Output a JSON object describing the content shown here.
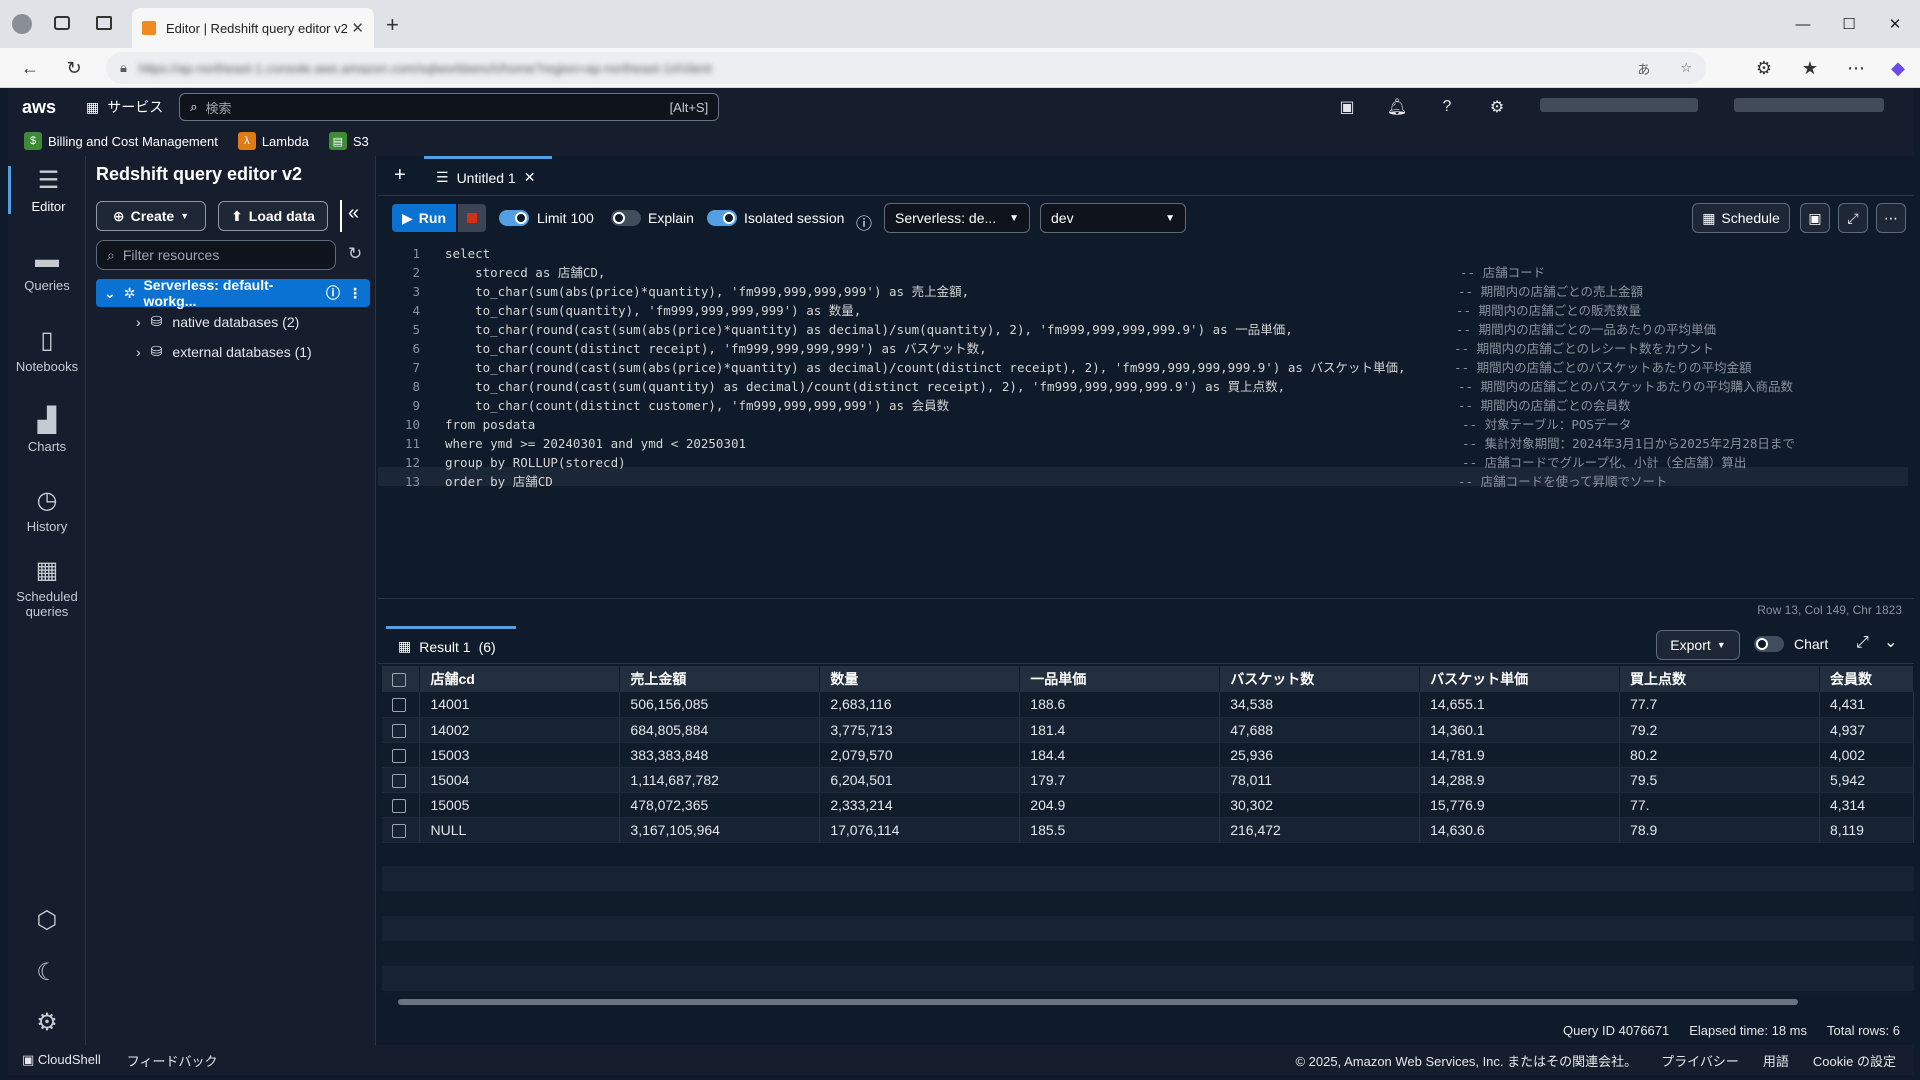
{
  "browser": {
    "tab_title": "Editor | Redshift query editor v2",
    "url": "https://ap-northeast-1.console.aws.amazon.com/sqlworkbench/home?region=ap-northeast-1#/client"
  },
  "aws_header": {
    "logo": "aws",
    "services_label": "サービス",
    "search_placeholder": "検索",
    "search_shortcut": "[Alt+S]"
  },
  "favorites": [
    {
      "label": "Billing and Cost Management",
      "color": "#3d8b37"
    },
    {
      "label": "Lambda",
      "color": "#e07b17"
    },
    {
      "label": "S3",
      "color": "#3d8b37"
    }
  ],
  "rail": {
    "editor": "Editor",
    "queries": "Queries",
    "notebooks": "Notebooks",
    "charts": "Charts",
    "history": "History",
    "scheduled": "Scheduled queries"
  },
  "resources": {
    "title": "Redshift query editor v2",
    "create_label": "Create",
    "load_label": "Load data",
    "filter_placeholder": "Filter resources",
    "workgroup": "Serverless: default-workg...",
    "native_db": "native databases (2)",
    "external_db": "external databases (1)"
  },
  "editor": {
    "tab_title": "Untitled 1",
    "run_label": "Run",
    "limit_label": "Limit 100",
    "explain_label": "Explain",
    "isolated_label": "Isolated session",
    "connection": "Serverless: de...",
    "database": "dev",
    "schedule_label": "Schedule",
    "status": "Row 13,  Col 149,  Chr 1823"
  },
  "code_lines": [
    {
      "n": "1",
      "code": "select",
      "comment": ""
    },
    {
      "n": "2",
      "code": "    storecd as 店舗CD,",
      "comment": "-- 店舗コード"
    },
    {
      "n": "3",
      "code": "    to_char(sum(abs(price)*quantity), 'fm999,999,999,999') as 売上金額,",
      "comment": "-- 期間内の店舗ごとの売上金額"
    },
    {
      "n": "4",
      "code": "    to_char(sum(quantity), 'fm999,999,999,999') as 数量,",
      "comment": "-- 期間内の店舗ごとの販売数量"
    },
    {
      "n": "5",
      "code": "    to_char(round(cast(sum(abs(price)*quantity) as decimal)/sum(quantity), 2), 'fm999,999,999,999.9') as 一品単価,",
      "comment": "-- 期間内の店舗ごとの一品あたりの平均単価"
    },
    {
      "n": "6",
      "code": "    to_char(count(distinct receipt), 'fm999,999,999,999') as バスケット数,",
      "comment": "-- 期間内の店舗ごとのレシート数をカウント"
    },
    {
      "n": "7",
      "code": "    to_char(round(cast(sum(abs(price)*quantity) as decimal)/count(distinct receipt), 2), 'fm999,999,999,999.9') as バスケット単価,",
      "comment": "-- 期間内の店舗ごとのバスケットあたりの平均金額"
    },
    {
      "n": "8",
      "code": "    to_char(round(cast(sum(quantity) as decimal)/count(distinct receipt), 2), 'fm999,999,999,999.9') as 買上点数,",
      "comment": "-- 期間内の店舗ごとのバスケットあたりの平均購入商品数"
    },
    {
      "n": "9",
      "code": "    to_char(count(distinct customer), 'fm999,999,999,999') as 会員数",
      "comment": "-- 期間内の店舗ごとの会員数"
    },
    {
      "n": "10",
      "code": "from posdata",
      "comment": "-- 対象テーブル：POSデータ"
    },
    {
      "n": "11",
      "code": "where ymd >= 20240301 and ymd < 20250301",
      "comment": "-- 集計対象期間：2024年3月1日から2025年2月28日まで"
    },
    {
      "n": "12",
      "code": "group by ROLLUP(storecd)",
      "comment": "-- 店舗コードでグループ化、小計（全店舗）算出"
    },
    {
      "n": "13",
      "code": "order by 店舗CD",
      "comment": "-- 店舗コードを使って昇順でソート"
    }
  ],
  "result": {
    "tab_label": "Result 1",
    "count": "(6)",
    "export_label": "Export",
    "chart_label": "Chart",
    "columns": [
      "店舗cd",
      "売上金額",
      "数量",
      "一品単価",
      "バスケット数",
      "バスケット単価",
      "買上点数",
      "会員数"
    ],
    "rows": [
      [
        "14001",
        "506,156,085",
        "2,683,116",
        "188.6",
        "34,538",
        "14,655.1",
        "77.7",
        "4,431"
      ],
      [
        "14002",
        "684,805,884",
        "3,775,713",
        "181.4",
        "47,688",
        "14,360.1",
        "79.2",
        "4,937"
      ],
      [
        "15003",
        "383,383,848",
        "2,079,570",
        "184.4",
        "25,936",
        "14,781.9",
        "80.2",
        "4,002"
      ],
      [
        "15004",
        "1,114,687,782",
        "6,204,501",
        "179.7",
        "78,011",
        "14,288.9",
        "79.5",
        "5,942"
      ],
      [
        "15005",
        "478,072,365",
        "2,333,214",
        "204.9",
        "30,302",
        "15,776.9",
        "77.",
        "4,314"
      ],
      [
        "NULL",
        "3,167,105,964",
        "17,076,114",
        "185.5",
        "216,472",
        "14,630.6",
        "78.9",
        "8,119"
      ]
    ],
    "query_id": "Query ID 4076671",
    "elapsed": "Elapsed time: 18 ms",
    "total_rows": "Total rows: 6"
  },
  "footer": {
    "cloudshell": "CloudShell",
    "feedback": "フィードバック",
    "copyright": "© 2025, Amazon Web Services, Inc. またはその関連会社。",
    "privacy": "プライバシー",
    "terms": "用語",
    "cookie": "Cookie の設定"
  }
}
